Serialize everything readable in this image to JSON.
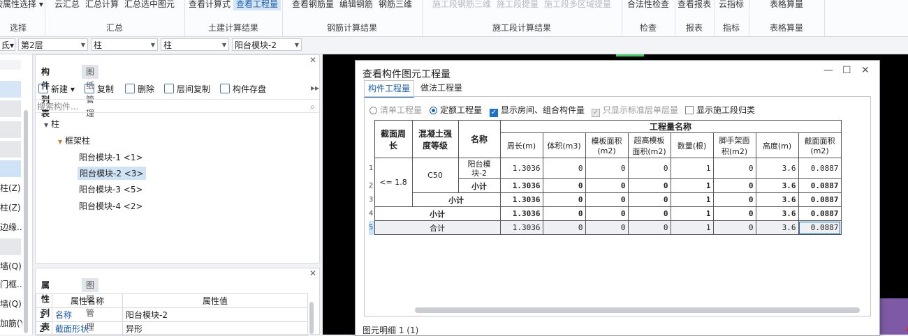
{
  "ribbon": {
    "groups": [
      {
        "label": "选择",
        "buttons": [
          {
            "text": "按属性选择 ▾",
            "state": "normal"
          }
        ]
      },
      {
        "label": "汇总",
        "buttons": [
          {
            "text": "云汇总",
            "state": "normal"
          },
          {
            "text": "汇总计算",
            "state": "normal"
          },
          {
            "text": "汇总选中图元",
            "state": "normal"
          }
        ]
      },
      {
        "label": "土建计算结果",
        "buttons": [
          {
            "text": "查看计算式",
            "state": "normal"
          },
          {
            "text": "查看工程量",
            "state": "active"
          }
        ]
      },
      {
        "label": "钢筋计算结果",
        "buttons": [
          {
            "text": "查看钢筋量",
            "state": "normal"
          },
          {
            "text": "编辑钢筋",
            "state": "normal"
          },
          {
            "text": "钢筋三维",
            "state": "normal"
          }
        ]
      },
      {
        "label": "施工段计算结果",
        "buttons": [
          {
            "text": "施工段钢筋三维",
            "state": "disabled"
          },
          {
            "text": "施工段提量",
            "state": "disabled"
          },
          {
            "text": "施工段多区域提量",
            "state": "disabled"
          }
        ]
      },
      {
        "label": "检查",
        "buttons": [
          {
            "text": "合法性检查",
            "state": "normal"
          }
        ]
      },
      {
        "label": "报表",
        "buttons": [
          {
            "text": "查看报表",
            "state": "normal"
          }
        ]
      },
      {
        "label": "指标",
        "buttons": [
          {
            "text": "云指标",
            "state": "normal"
          }
        ]
      },
      {
        "label": "表格算量",
        "buttons": [
          {
            "text": "表格算量",
            "state": "normal"
          }
        ]
      }
    ]
  },
  "filterbar": {
    "combo0": "氐▾",
    "floor": "第2层",
    "type1": "柱",
    "type2": "柱",
    "component": "阳台模块-2"
  },
  "leftnav": {
    "items": [
      "柱(Z)",
      "柱(Z)",
      "边缘...",
      "墙(Q)",
      "门框...",
      "墙(Q)",
      "加筋(Y"
    ]
  },
  "complist": {
    "tab_active": "构件列表",
    "tab_inactive": "图纸管理",
    "tools": [
      "新建 ▾",
      "复制",
      "删除",
      "层间复制",
      "构件存盘"
    ],
    "search_placeholder": "搜索构件...",
    "tree": {
      "root": "柱",
      "child": "框架柱",
      "items": [
        "阳台模块-1 <1>",
        "阳台模块-2 <3>",
        "阳台模块-3 <5>",
        "阳台模块-4 <2>"
      ],
      "selected_index": 1
    }
  },
  "proppanel": {
    "tab_active": "属性列表",
    "tab_inactive": "图层管理",
    "col_name": "属性名称",
    "col_value": "属性值",
    "rows": [
      {
        "no": "1",
        "name": "名称",
        "value": "阳台模块-2"
      },
      {
        "no": "2",
        "name": "截面形状",
        "value": "异形"
      }
    ]
  },
  "dialog": {
    "title": "查看构件图元工程量",
    "tab_active": "构件工程量",
    "tab_inactive": "做法工程量",
    "opt_list": "清单工程量",
    "opt_quota": "定额工程量",
    "opt_show_room": "显示房间、组合构件量",
    "opt_std_floor": "只显示标准层单层量",
    "opt_construct": "显示施工段归类",
    "table": {
      "h_section": "截面周长",
      "h_concrete": "混凝土强度等级",
      "h_name": "名称",
      "h_group": "工程量名称",
      "cols": [
        "周长(m)",
        "体积(m3)",
        "模板面积(m2)",
        "超高模板面积(m2)",
        "数量(根)",
        "脚手架面积(m2)",
        "高度(m)",
        "截面面积(m2)"
      ],
      "sec_val": "<= 1.8",
      "conc_val": "C50",
      "row1": {
        "no": "1",
        "name": "阳台模块-2",
        "vals": [
          "1.3036",
          "0",
          "0",
          "0",
          "1",
          "0",
          "3.6",
          "0.0887"
        ]
      },
      "row2": {
        "no": "2",
        "label": "小计",
        "vals": [
          "1.3036",
          "0",
          "0",
          "0",
          "1",
          "0",
          "3.6",
          "0.0887"
        ]
      },
      "row3": {
        "no": "3",
        "label": "小计",
        "vals": [
          "1.3036",
          "0",
          "0",
          "0",
          "1",
          "0",
          "3.6",
          "0.0887"
        ]
      },
      "row4": {
        "no": "4",
        "label": "小计",
        "vals": [
          "1.3036",
          "0",
          "0",
          "0",
          "1",
          "0",
          "3.6",
          "0.0887"
        ]
      },
      "row5": {
        "no": "5",
        "label": "合计",
        "vals": [
          "1.3036",
          "0",
          "0",
          "0",
          "1",
          "0",
          "3.6",
          "0.0887"
        ]
      }
    },
    "footer": "图元明细  1 (1)"
  },
  "colors": {
    "accent": "#1d5fae",
    "arrow": "#e0262a"
  }
}
